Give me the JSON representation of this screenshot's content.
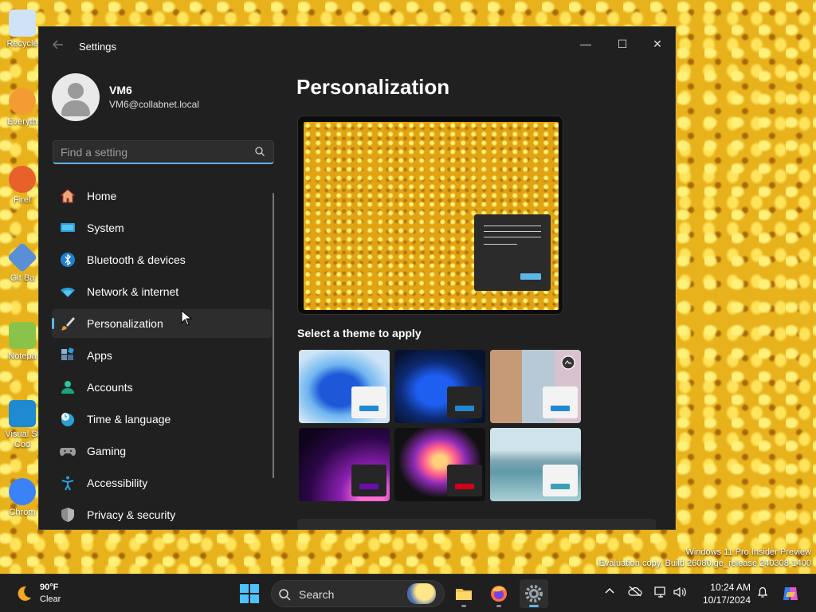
{
  "desktop": {
    "icons": [
      {
        "label": "Recycle",
        "color": "#cfe3f5"
      },
      {
        "label": "Everyth",
        "color": "#f39c34"
      },
      {
        "label": "Firef",
        "color": "#e8602c"
      },
      {
        "label": "Git Ba",
        "color": "#5a8fd6"
      },
      {
        "label": "Notepa",
        "color": "#8bc34a"
      },
      {
        "label": "Visual St Cod",
        "color": "#1f8ad2"
      },
      {
        "label": "Chrom",
        "color": "#3b82f6"
      }
    ]
  },
  "window": {
    "title": "Settings",
    "min_glyph": "—",
    "max_glyph": "☐",
    "close_glyph": "✕"
  },
  "user": {
    "name": "VM6",
    "email": "VM6@collabnet.local"
  },
  "search": {
    "placeholder": "Find a setting"
  },
  "nav": {
    "items": [
      {
        "label": "Home",
        "icon": "home-icon",
        "active": false
      },
      {
        "label": "System",
        "icon": "system-icon",
        "active": false
      },
      {
        "label": "Bluetooth & devices",
        "icon": "bluetooth-icon",
        "active": false
      },
      {
        "label": "Network & internet",
        "icon": "wifi-icon",
        "active": false
      },
      {
        "label": "Personalization",
        "icon": "brush-icon",
        "active": true
      },
      {
        "label": "Apps",
        "icon": "apps-icon",
        "active": false
      },
      {
        "label": "Accounts",
        "icon": "accounts-icon",
        "active": false
      },
      {
        "label": "Time & language",
        "icon": "clock-globe-icon",
        "active": false
      },
      {
        "label": "Gaming",
        "icon": "gamepad-icon",
        "active": false
      },
      {
        "label": "Accessibility",
        "icon": "accessibility-icon",
        "active": false
      },
      {
        "label": "Privacy & security",
        "icon": "shield-icon",
        "active": false
      }
    ]
  },
  "main": {
    "title": "Personalization",
    "theme_heading": "Select a theme to apply",
    "themes": [
      {
        "name": "windows-light",
        "accent": "#1f8ad2"
      },
      {
        "name": "windows-dark",
        "accent": "#1f8ad2"
      },
      {
        "name": "glow",
        "accent": "#1f8ad2"
      },
      {
        "name": "captured-motion",
        "accent": "#6a0dad"
      },
      {
        "name": "flow",
        "accent": "#d0021b"
      },
      {
        "name": "sunrise",
        "accent": "#3aa0b8"
      }
    ]
  },
  "watermark": {
    "line1": "Windows 11 Pro Insider Preview",
    "line2": "Evaluation copy. Build 26080.ge_release.240308-1400"
  },
  "taskbar": {
    "weather_temp": "90°F",
    "weather_cond": "Clear",
    "search_label": "Search",
    "time": "10:24 AM",
    "date": "10/17/2024"
  },
  "colors": {
    "accent": "#5eb6e8",
    "window_bg": "#202020"
  }
}
